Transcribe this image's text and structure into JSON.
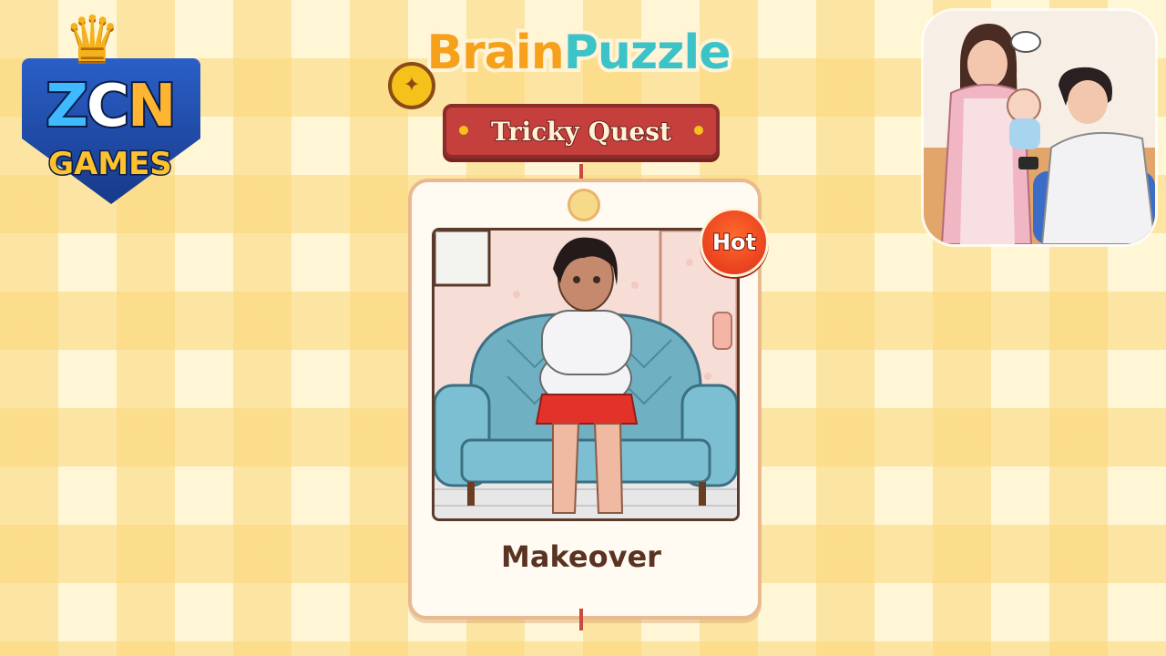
{
  "publisher_logo": {
    "text_parts": [
      "Z",
      "C",
      "N"
    ],
    "subtitle": "GAMES"
  },
  "game_title": {
    "word1": "Brain",
    "word2": "Puzzle",
    "subtitle": "Tricky Quest"
  },
  "level_card": {
    "name": "Makeover",
    "badge": "Hot"
  },
  "icons": {
    "crown": "crown-icon",
    "bulb": "lightbulb-icon",
    "flame": "flame-icon"
  },
  "colors": {
    "accent_orange": "#f6a11c",
    "accent_teal": "#3cc3c7",
    "banner_red": "#c5403c",
    "hot_red": "#e0301a"
  }
}
